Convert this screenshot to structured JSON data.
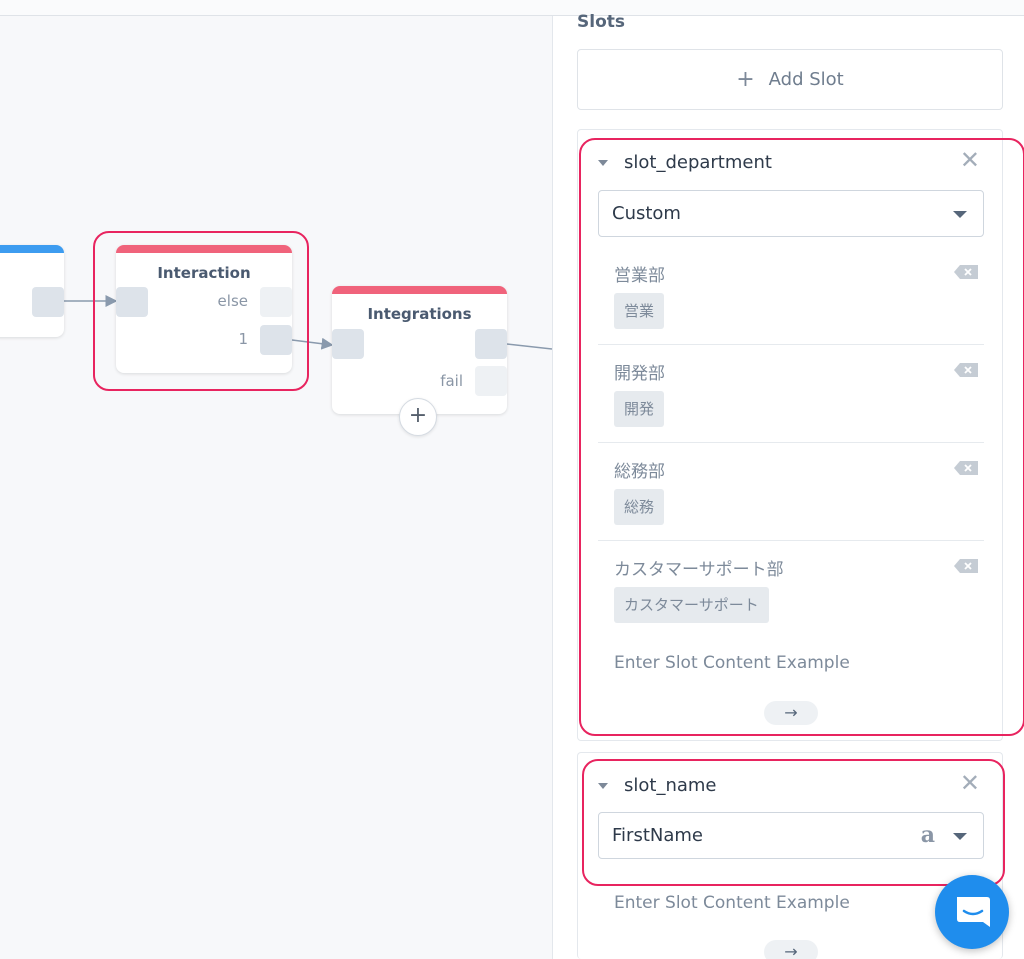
{
  "canvas": {
    "nodes": {
      "interaction": {
        "title": "Interaction",
        "ports": [
          "else",
          "1"
        ],
        "strip_color": "#f0637b"
      },
      "integrations": {
        "title": "Integrations",
        "ports": [
          "fail"
        ],
        "strip_color": "#f0637b"
      },
      "left_node": {
        "strip_color": "#3d9cf0"
      }
    },
    "add_node_icon": "plus-icon",
    "highlight_color": "#e8245f"
  },
  "panel": {
    "heading": "Slots",
    "add_slot_label": "Add Slot",
    "slots": [
      {
        "name": "slot_department",
        "type": "Custom",
        "values": [
          {
            "name": "営業部",
            "synonym": "営業"
          },
          {
            "name": "開発部",
            "synonym": "開発"
          },
          {
            "name": "総務部",
            "synonym": "総務"
          },
          {
            "name": "カスタマーサポート部",
            "synonym": "カスタマーサポート"
          }
        ],
        "example_placeholder": "Enter Slot Content Example",
        "next_icon": "arrow-right-icon"
      },
      {
        "name": "slot_name",
        "type": "FirstName",
        "type_provider_icon": "amazon-icon",
        "example_placeholder": "Enter Slot Content Example",
        "next_icon": "arrow-right-icon"
      }
    ]
  },
  "chat": {
    "icon": "chat-bubble-icon",
    "color": "#1f8ded"
  }
}
